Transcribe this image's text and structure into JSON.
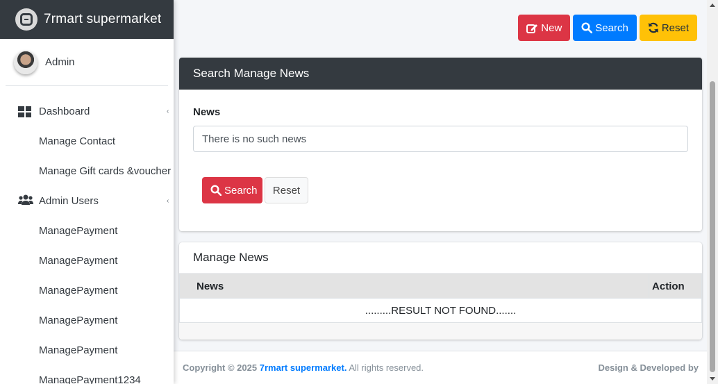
{
  "brand": {
    "title": "7rmart supermarket"
  },
  "user": {
    "name": "Admin"
  },
  "sidebar": {
    "items": [
      {
        "label": "Dashboard",
        "icon": "dashboard-grid-icon",
        "caret": "‹"
      },
      {
        "label": "Manage Contact"
      },
      {
        "label": "Manage Gift cards &voucher"
      },
      {
        "label": "Admin Users",
        "icon": "users-icon",
        "caret": "‹"
      },
      {
        "label": "ManagePayment"
      },
      {
        "label": "ManagePayment"
      },
      {
        "label": "ManagePayment"
      },
      {
        "label": "ManagePayment"
      },
      {
        "label": "ManagePayment"
      },
      {
        "label": "ManagePayment1234"
      }
    ]
  },
  "toolbar": {
    "new_label": "New",
    "search_label": "Search",
    "reset_label": "Reset"
  },
  "search_card": {
    "title": "Search Manage News",
    "field_label": "News",
    "field_value": "There is no such news",
    "search_button": "Search",
    "reset_button": "Reset"
  },
  "list_card": {
    "title": "Manage News",
    "columns": [
      "News",
      "Action"
    ],
    "empty_message": ".........RESULT NOT FOUND......."
  },
  "footer": {
    "copyright_prefix": "Copyright © 2025",
    "company": "7rmart supermarket.",
    "rights": "All rights reserved.",
    "right_text": "Design & Developed by"
  },
  "colors": {
    "sidebar_header": "#343a40",
    "danger": "#dc3545",
    "primary": "#007bff",
    "warning": "#ffc107"
  }
}
